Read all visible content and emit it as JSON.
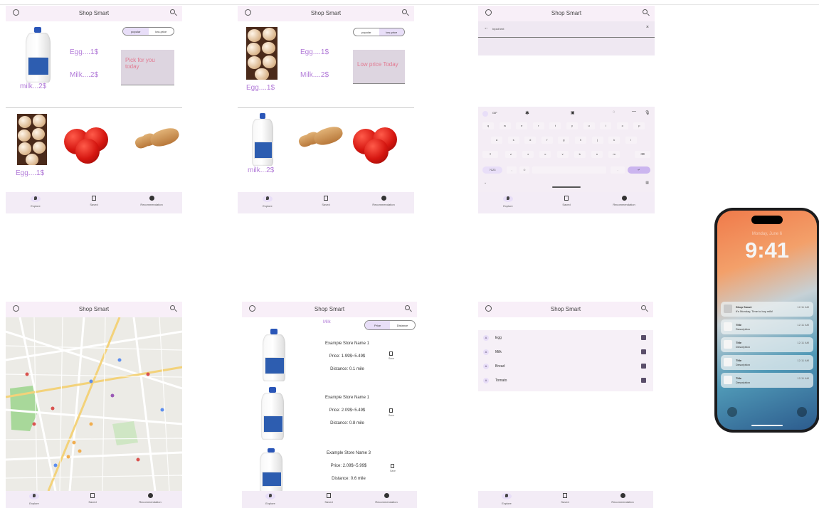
{
  "app": {
    "title": "Shop Smart"
  },
  "nav": {
    "explore": "Explore",
    "saved": "Saved",
    "recommendation": "Recommendation"
  },
  "screen1": {
    "milk_label": "milk...2$",
    "egg_price": "Egg....1$",
    "milk_price": "Milk....2$",
    "seg_left": "popular",
    "seg_right": "low-price",
    "note": "Pick for you today",
    "bottom_label": "Egg....1$"
  },
  "screen2": {
    "egg_label": "Egg....1$",
    "egg_price": "Egg....1$",
    "milk_price": "Milk....2$",
    "seg_left": "popular",
    "seg_right": "low-price",
    "note": "Low price Today",
    "bottom_label": "milk...2$"
  },
  "screen3": {
    "search_placeholder": "Input text",
    "keyboard": {
      "gif": "GIF",
      "row1": [
        "q",
        "w",
        "e",
        "r",
        "t",
        "y",
        "u",
        "i",
        "o",
        "p"
      ],
      "row2": [
        "a",
        "s",
        "d",
        "f",
        "g",
        "h",
        "j",
        "k",
        "l"
      ],
      "row3": [
        "z",
        "x",
        "c",
        "v",
        "b",
        "n",
        "m"
      ],
      "mode_key": "?123",
      "comma_key": ",",
      "period_key": ".",
      "enter_key": "↵"
    }
  },
  "screen5": {
    "product": "Milk",
    "seg_left": "Price",
    "seg_right": "Distance",
    "save_label": "Save",
    "stores": [
      {
        "name": "Example Store Name 1",
        "price": "Price: 1.99$~5.49$",
        "distance": "Distance: 0.1 mile"
      },
      {
        "name": "Example Store Name 1",
        "price": "Price: 2.09$~5.49$",
        "distance": "Distance: 0.8 mile"
      },
      {
        "name": "Example Store Name 3",
        "price": "Price: 2.09$~5.99$",
        "distance": "Distance: 0.6 mile"
      }
    ]
  },
  "screen6": {
    "items": [
      {
        "letter": "A",
        "label": "Egg"
      },
      {
        "letter": "A",
        "label": "Milk"
      },
      {
        "letter": "A",
        "label": "Bread"
      },
      {
        "letter": "A",
        "label": "Tomato"
      }
    ]
  },
  "phone": {
    "date": "Monday, June 6",
    "time": "9:41",
    "notifications": [
      {
        "title": "Shop Smart",
        "desc": "It's Monday, Time to buy milk!",
        "time": "12:11 AM"
      },
      {
        "title": "Title",
        "desc": "Description",
        "time": "12:11 AM"
      },
      {
        "title": "Title",
        "desc": "Description",
        "time": "12:11 AM"
      },
      {
        "title": "Title",
        "desc": "Description",
        "time": "12:11 AM"
      },
      {
        "title": "Title",
        "desc": "Description",
        "time": "12:11 AM"
      }
    ]
  }
}
